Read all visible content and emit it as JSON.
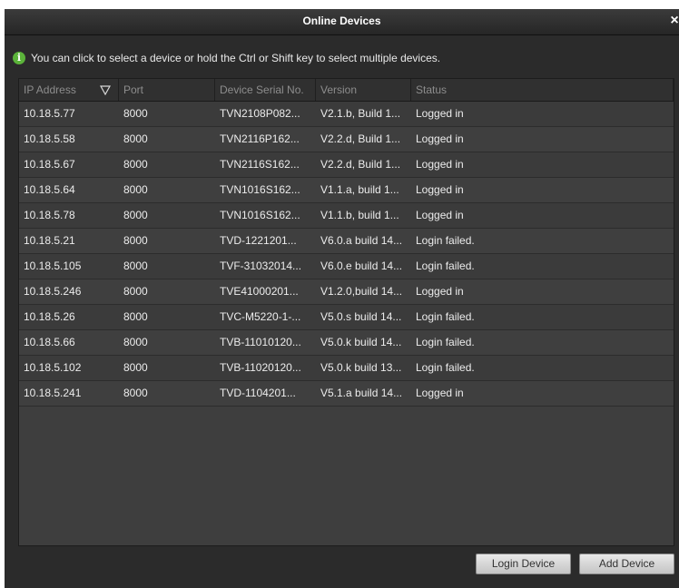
{
  "window": {
    "title": "Online Devices",
    "close_glyph": "×"
  },
  "hint": {
    "icon": "info-icon",
    "icon_glyph": "i",
    "text": "You can click to select a device or hold the Ctrl or Shift key to select multiple devices."
  },
  "table": {
    "columns": [
      "IP Address",
      "Port",
      "Device Serial No.",
      "Version",
      "Status"
    ],
    "rows": [
      [
        "10.18.5.77",
        "8000",
        "TVN2108P082...",
        "V2.1.b, Build 1...",
        "Logged in"
      ],
      [
        "10.18.5.58",
        "8000",
        "TVN2116P162...",
        "V2.2.d, Build 1...",
        "Logged in"
      ],
      [
        "10.18.5.67",
        "8000",
        "TVN2116S162...",
        "V2.2.d, Build 1...",
        "Logged in"
      ],
      [
        "10.18.5.64",
        "8000",
        "TVN1016S162...",
        "V1.1.a, build 1...",
        "Logged in"
      ],
      [
        "10.18.5.78",
        "8000",
        "TVN1016S162...",
        "V1.1.b, build 1...",
        "Logged in"
      ],
      [
        "10.18.5.21",
        "8000",
        "TVD-1221201...",
        "V6.0.a build 14...",
        "Login failed."
      ],
      [
        "10.18.5.105",
        "8000",
        "TVF-31032014...",
        "V6.0.e build 14...",
        "Login failed."
      ],
      [
        "10.18.5.246",
        "8000",
        "TVE41000201...",
        "V1.2.0,build 14...",
        "Logged in"
      ],
      [
        "10.18.5.26",
        "8000",
        "TVC-M5220-1-...",
        "V5.0.s build 14...",
        "Login failed."
      ],
      [
        "10.18.5.66",
        "8000",
        "TVB-11010120...",
        "V5.0.k build 14...",
        "Login failed."
      ],
      [
        "10.18.5.102",
        "8000",
        "TVB-11020120...",
        "V5.0.k build 13...",
        "Login failed."
      ],
      [
        "10.18.5.241",
        "8000",
        "TVD-1104201...",
        "V5.1.a build 14...",
        "Logged in"
      ]
    ]
  },
  "buttons": {
    "login": "Login Device",
    "add": "Add Device"
  },
  "colors": {
    "dialog_bg": "#2b2b2b",
    "table_bg": "#3e3e3e",
    "accent_green": "#5bb33a"
  }
}
